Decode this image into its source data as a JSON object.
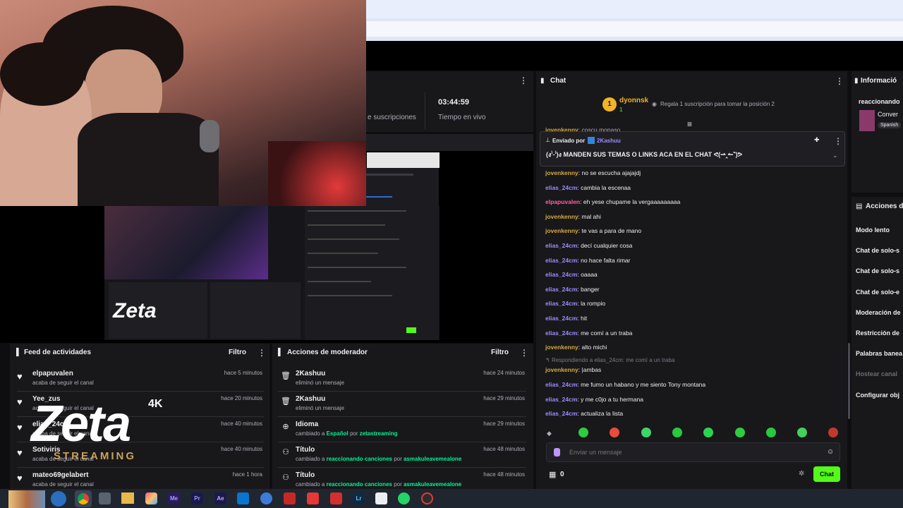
{
  "stream_stats": {
    "suscripciones_label": "e suscripciones",
    "time_value": "03:44:59",
    "time_label": "Tiempo en vivo"
  },
  "watermark": {
    "brand": "Zeta",
    "badge": "4K",
    "sub": "STREAMING"
  },
  "feed": {
    "title": "Feed de actividades",
    "filter": "Filtro",
    "items": [
      {
        "name": "elpapuvalen",
        "sub": "acaba de seguir el canal",
        "time": "hace 5 minutos"
      },
      {
        "name": "Yee_zus",
        "sub": "acaba de seguir el canal",
        "time": "hace 20 minutos"
      },
      {
        "name": "elias_24cm",
        "sub": "acaba de seguir el canal",
        "time": "hace 40 minutos"
      },
      {
        "name": "Sotiviris",
        "sub": "acaba de seguir el canal",
        "time": "hace 40 minutos"
      },
      {
        "name": "mateo69gelabert",
        "sub": "acaba de seguir el canal",
        "time": "hace 1 hora"
      }
    ]
  },
  "mod": {
    "title": "Acciones de moderador",
    "filter": "Filtro",
    "items": [
      {
        "name": "2Kashuu",
        "sub_a": "eliminó un mensaje",
        "sub_b": "",
        "sub_c": "",
        "sub_d": "",
        "time": "hace 24 minutos",
        "icon": "trash-icon"
      },
      {
        "name": "2Kashuu",
        "sub_a": "eliminó un mensaje",
        "sub_b": "",
        "sub_c": "",
        "sub_d": "",
        "time": "hace 29 minutos",
        "icon": "trash-icon"
      },
      {
        "name": "Idioma",
        "sub_a": "cambiado a ",
        "sub_b": "Español",
        "sub_c": " por ",
        "sub_d": "zetastreaming",
        "time": "hace 29 minutos",
        "icon": "globe-icon"
      },
      {
        "name": "Título",
        "sub_a": "cambiado a ",
        "sub_b": "reaccionando canciones",
        "sub_c": " por ",
        "sub_d": "asmakuleavemealone",
        "time": "hace 48 minutos",
        "icon": "people-icon"
      },
      {
        "name": "Título",
        "sub_a": "cambiado a ",
        "sub_b": "reaccionando canciones",
        "sub_c": " por ",
        "sub_d": "asmakuleavemealone",
        "time": "hace 48 minutos",
        "icon": "people-icon"
      }
    ]
  },
  "chat": {
    "title": "Chat",
    "leader": {
      "rank": "1",
      "name": "dyonnsk",
      "count": "1",
      "promo": "Regala 1 suscripción para tomar la posición 2"
    },
    "cut_message": {
      "user": "jovenkenny",
      "text": ": coscu monaso"
    },
    "pinned": {
      "label": "Enviado por",
      "user": "2Kashuu",
      "text": "(ง'̀-'́)ง MANDEN SUS TEMAS O LINKS ACA EN EL CHAT ᕙ(⇀‸↼‶)ᕗ"
    },
    "messages": [
      {
        "user": "jovenkenny",
        "text": ": no se escucha ajajajdj",
        "cls": "u-joven"
      },
      {
        "user": "elias_24cm",
        "text": ": cambia la escenaa",
        "cls": "u-elias"
      },
      {
        "user": "elpapuvalen",
        "text": ": eh yese chupame la vergaaaaaaaaa",
        "cls": "u-elpapu"
      },
      {
        "user": "jovenkenny",
        "text": ": mal ahi",
        "cls": "u-joven"
      },
      {
        "user": "jovenkenny",
        "text": ": te vas a para de mano",
        "cls": "u-joven"
      },
      {
        "user": "elias_24cm",
        "text": ": decí cualquier cosa",
        "cls": "u-elias"
      },
      {
        "user": "elias_24cm",
        "text": ": no hace falta rimar",
        "cls": "u-elias"
      },
      {
        "user": "elias_24cm",
        "text": ": oaaaa",
        "cls": "u-elias"
      },
      {
        "user": "elias_24cm",
        "text": ": banger",
        "cls": "u-elias"
      },
      {
        "user": "elias_24cm",
        "text": ": la rompio",
        "cls": "u-elias"
      },
      {
        "user": "elias_24cm",
        "text": ": hit",
        "cls": "u-elias"
      },
      {
        "user": "elias_24cm",
        "text": ": me comí a un traba",
        "cls": "u-elias"
      },
      {
        "user": "jovenkenny",
        "text": ": alto michi",
        "cls": "u-joven"
      }
    ],
    "reply": {
      "context": "Respondiendo a elias_24cm: me comí a un traba",
      "user": "jovenkenny",
      "text": ": |ambas"
    },
    "messages2": [
      {
        "user": "elias_24cm",
        "text": ": me fumo un habano y me siento Tony montana",
        "cls": "u-elias"
      },
      {
        "user": "elias_24cm",
        "text": ": y me c0jo a tu hermana",
        "cls": "u-elias"
      },
      {
        "user": "elias_24cm",
        "text": ": actualiza la lista",
        "cls": "u-elias"
      }
    ],
    "input_placeholder": "Enviar un mensaje",
    "points": "0",
    "send_label": "Chat",
    "emote_colors": [
      "#2ecc40",
      "#e74c3c",
      "#3fd46a",
      "#27c93f",
      "#2bd44e",
      "#2ecc40",
      "#27c93f",
      "#44d15a",
      "#c0392b",
      "#2ecc40"
    ]
  },
  "info": {
    "title": "Informació",
    "stream_title": "reaccionando",
    "category": "Conver",
    "lang_tag": "Spanish"
  },
  "actions": {
    "title": "Acciones de",
    "items": [
      "Modo lento",
      "Chat de solo-s",
      "Chat de solo-s",
      "Chat de solo-e",
      "Moderación de",
      "Restricción de",
      "Palabras banea",
      "Hostear canal",
      "Configurar obj"
    ]
  },
  "taskbar": {
    "icons": [
      "Me",
      "Pr",
      "Ae",
      "Lr"
    ]
  },
  "colors": {
    "accent_green": "#53fc18",
    "purple": "#bf94ff",
    "panel": "#18181b",
    "bg": "#0e0e10"
  }
}
